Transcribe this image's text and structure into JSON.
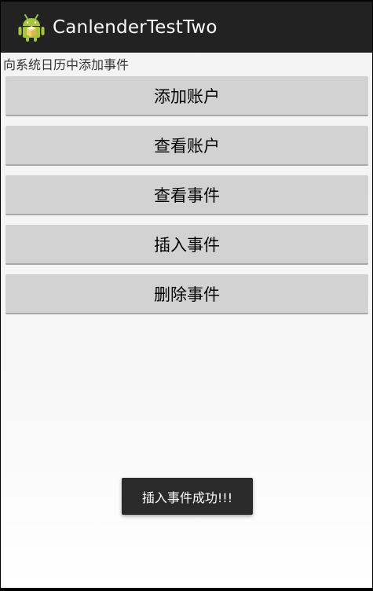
{
  "action_bar": {
    "title": "CanlenderTestTwo",
    "icon": "android-robot-icon",
    "background": "#222222"
  },
  "main": {
    "description": "向系统日历中添加事件",
    "buttons": [
      {
        "label": "添加账户"
      },
      {
        "label": "查看账户"
      },
      {
        "label": "查看事件"
      },
      {
        "label": "插入事件"
      },
      {
        "label": "删除事件"
      }
    ]
  },
  "toast": {
    "message": "插入事件成功!!!"
  }
}
